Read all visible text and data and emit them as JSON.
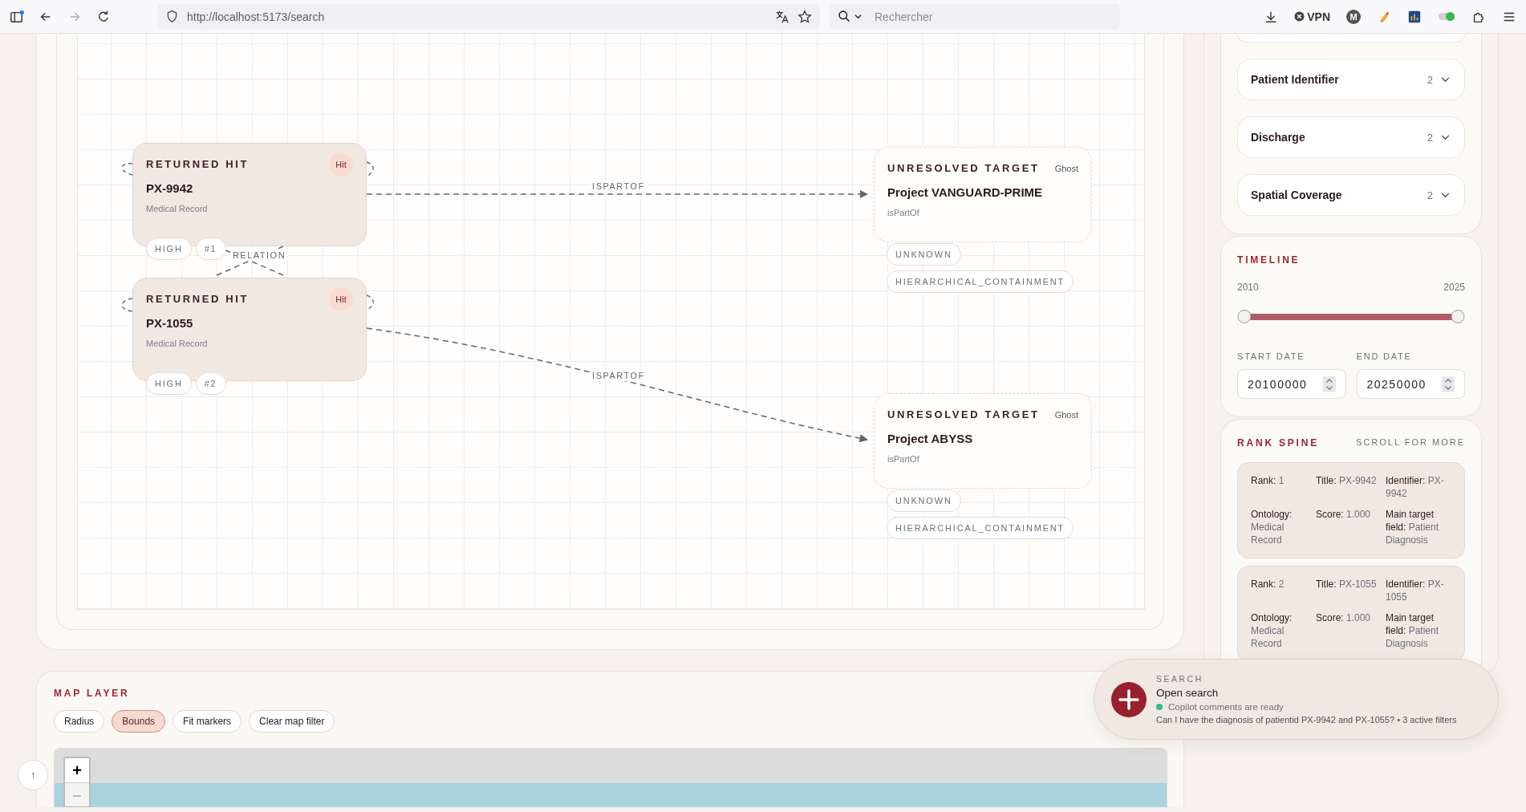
{
  "browser": {
    "url": "http://localhost:5173/search",
    "search_placeholder": "Rechercher",
    "vpn_label": "VPN",
    "profile_initial": "M"
  },
  "graph": {
    "nodes": [
      {
        "kind": "hit",
        "heading": "RETURNED HIT",
        "badge": "Hit",
        "title": "PX-9942",
        "subtitle": "Medical Record",
        "chips": [
          "HIGH",
          "#1"
        ]
      },
      {
        "kind": "hit",
        "heading": "RETURNED HIT",
        "badge": "Hit",
        "title": "PX-1055",
        "subtitle": "Medical Record",
        "chips": [
          "HIGH",
          "#2"
        ]
      },
      {
        "kind": "ghost",
        "heading": "UNRESOLVED TARGET",
        "badge": "Ghost",
        "title": "Project VANGUARD-PRIME",
        "subtitle": "isPartOf",
        "chips": [
          "UNKNOWN",
          "HIERARCHICAL_CONTAINMENT"
        ]
      },
      {
        "kind": "ghost",
        "heading": "UNRESOLVED TARGET",
        "badge": "Ghost",
        "title": "Project ABYSS",
        "subtitle": "isPartOf",
        "chips": [
          "UNKNOWN",
          "HIERARCHICAL_CONTAINMENT"
        ]
      }
    ],
    "edges": [
      {
        "kind": "arrow",
        "label": "ISPARTOF"
      },
      {
        "kind": "arrow",
        "label": "ISPARTOF"
      },
      {
        "kind": "cross",
        "label": "RELATION"
      }
    ]
  },
  "map": {
    "title": "MAP LAYER",
    "buttons": [
      {
        "label": "Radius",
        "selected": false
      },
      {
        "label": "Bounds",
        "selected": true
      },
      {
        "label": "Fit markers",
        "selected": false
      },
      {
        "label": "Clear map filter",
        "selected": false
      }
    ],
    "zoom_in": "+",
    "zoom_out": "–"
  },
  "scroll_top": "↑",
  "facets": [
    {
      "label": "Patient Identifier",
      "count": "2",
      "expanded": false
    },
    {
      "label": "Discharge",
      "count": "2",
      "expanded": false
    },
    {
      "label": "Spatial Coverage",
      "count": "2",
      "expanded": false
    }
  ],
  "timeline": {
    "title": "TIMELINE",
    "min_label": "2010",
    "max_label": "2025",
    "start": {
      "level": 0
    },
    "end": {
      "level": 1
    },
    "start_label": "START DATE",
    "start_value": "20100000",
    "end_label": "END DATE",
    "end_value": "20250000"
  },
  "rank_spine": {
    "title": "RANK SPINE",
    "hint": "SCROLL FOR MORE",
    "items": [
      {
        "fields": [
          {
            "label": "Rank:",
            "value": "1"
          },
          {
            "label": "Title:",
            "value": "PX-9942"
          },
          {
            "label": "Identifier:",
            "value": "PX-9942"
          },
          {
            "label": "Ontology:",
            "value": "Medical Record"
          },
          {
            "label": "Score:",
            "value": "1.000"
          },
          {
            "label": "Main target field:",
            "value": "Patient Diagnosis"
          }
        ]
      },
      {
        "fields": [
          {
            "label": "Rank:",
            "value": "2"
          },
          {
            "label": "Title:",
            "value": "PX-1055"
          },
          {
            "label": "Identifier:",
            "value": "PX-1055"
          },
          {
            "label": "Ontology:",
            "value": "Medical Record"
          },
          {
            "label": "Score:",
            "value": "1.000"
          },
          {
            "label": "Main target field:",
            "value": "Patient Diagnosis"
          }
        ]
      }
    ]
  },
  "search_widget": {
    "label": "SEARCH",
    "title": "Open search",
    "status": "Copilot comments are ready",
    "query": "Can I have the diagnosis of patientid PX-9942 and PX-1055? • 3 active filters"
  }
}
